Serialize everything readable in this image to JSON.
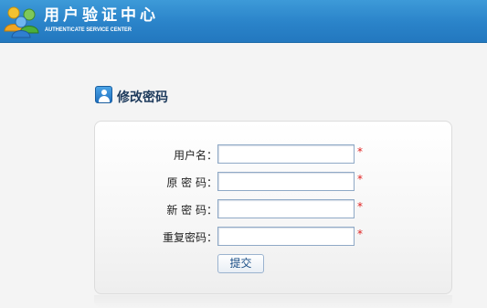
{
  "brand": {
    "title": "用户验证中心",
    "subtitle": "AUTHENTICATE SERVICE CENTER"
  },
  "section": {
    "title": "修改密码",
    "icon": "user-icon"
  },
  "form": {
    "fields": [
      {
        "label": "用户名：",
        "value": "",
        "required_mark": "*"
      },
      {
        "label": "原 密 码：",
        "value": "",
        "required_mark": "*"
      },
      {
        "label": "新 密 码：",
        "value": "",
        "required_mark": "*"
      },
      {
        "label": "重复密码：",
        "value": "",
        "required_mark": "*"
      }
    ],
    "submit_label": "提交"
  },
  "colors": {
    "header": "#2a83c9",
    "required": "#e0201f",
    "title": "#1d3a5c"
  }
}
